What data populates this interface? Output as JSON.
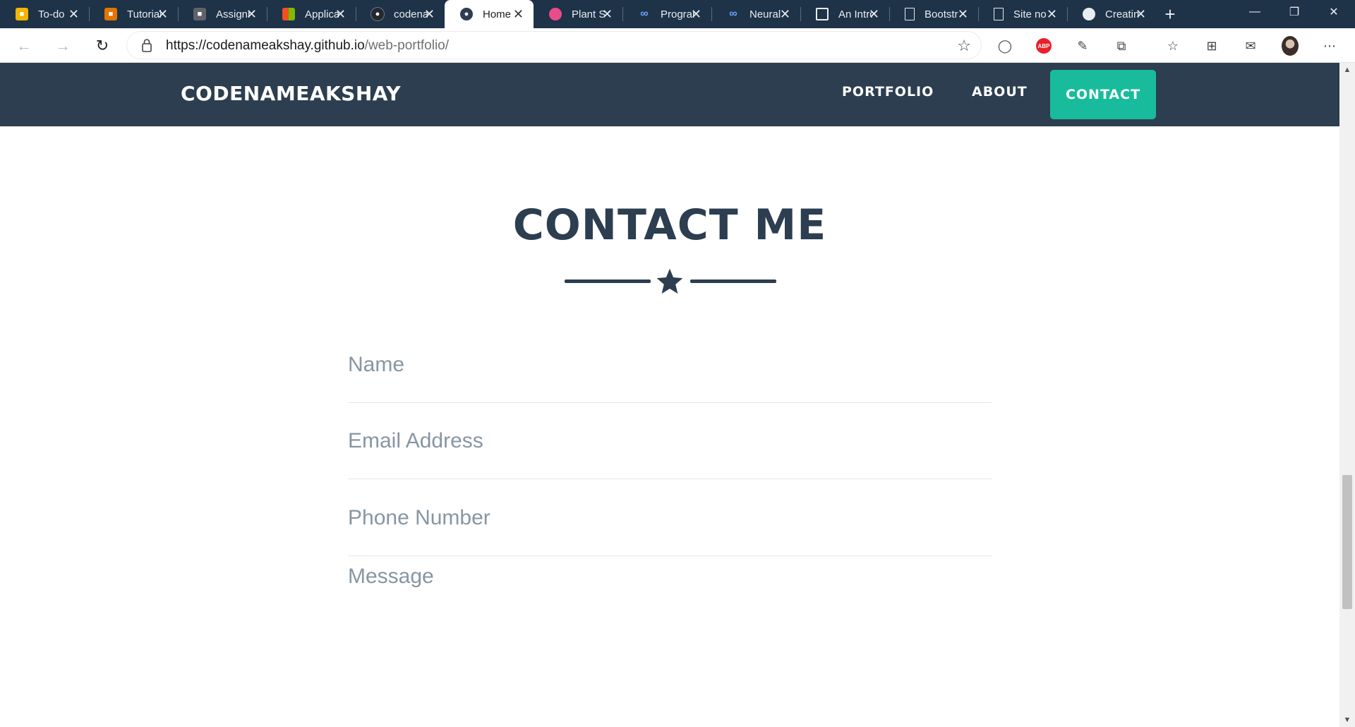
{
  "tabs": [
    {
      "title": "To-do",
      "icon": "classroom-icon",
      "color": "#f4b400",
      "active": false
    },
    {
      "title": "Tutorials",
      "icon": "classroom-icon",
      "color": "#e37400",
      "active": false
    },
    {
      "title": "Assignments",
      "icon": "classroom-icon",
      "color": "#5f6368",
      "active": false
    },
    {
      "title": "Applications",
      "icon": "microsoft-icon",
      "color": "#f25022",
      "active": false
    },
    {
      "title": "codenameakshay",
      "icon": "github-icon",
      "color": "#24292e",
      "active": false
    },
    {
      "title": "Home",
      "icon": "portfolio-icon",
      "color": "#2c3e50",
      "active": true
    },
    {
      "title": "Plant S",
      "icon": "dribbble-icon",
      "color": "#ea4c89",
      "active": false
    },
    {
      "title": "Programming",
      "icon": "coursera-icon",
      "color": "#2a73cc",
      "active": false
    },
    {
      "title": "Neural",
      "icon": "coursera-icon",
      "color": "#2a73cc",
      "active": false
    },
    {
      "title": "An Intro",
      "icon": "terminal-icon",
      "color": "#e8edf2",
      "active": false
    },
    {
      "title": "Bootstrap",
      "icon": "page-icon",
      "color": "#e8edf2",
      "active": false
    },
    {
      "title": "Site no",
      "icon": "page-icon",
      "color": "#e8edf2",
      "active": false
    },
    {
      "title": "Creating",
      "icon": "github-icon",
      "color": "#e8edf2",
      "active": false
    }
  ],
  "browser": {
    "url_host": "https://codenameakshay.github.io",
    "url_path": "/web-portfolio/",
    "abp_label": "ABP"
  },
  "site": {
    "brand": "CODENAMEAKSHAY",
    "nav": {
      "portfolio": "PORTFOLIO",
      "about": "ABOUT",
      "contact": "CONTACT"
    },
    "accent_color": "#18bc9c",
    "primary_color": "#2c3e50"
  },
  "contact_section": {
    "title": "CONTACT ME",
    "form": {
      "name_placeholder": "Name",
      "email_placeholder": "Email Address",
      "phone_placeholder": "Phone Number",
      "message_placeholder": "Message"
    }
  }
}
